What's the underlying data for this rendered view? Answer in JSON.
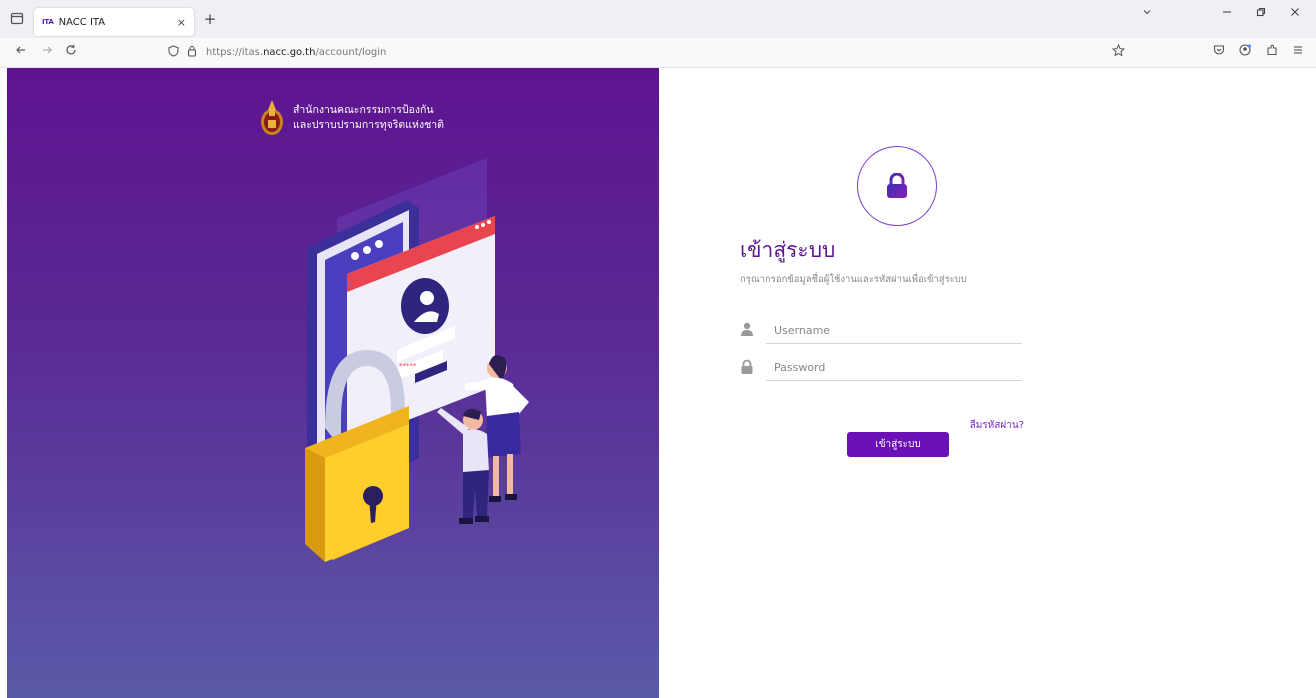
{
  "browser": {
    "tab_title": "NACC ITA",
    "tab_favicon_text": "ITA",
    "tab_close": "×",
    "new_tab": "+",
    "url_prefix": "https://itas.",
    "url_domain": "nacc.go.th",
    "url_path": "/account/login",
    "icons": [
      "tab-list-icon",
      "back-icon",
      "forward-icon",
      "reload-icon",
      "shield-icon",
      "lock-icon",
      "bookmark-star-icon",
      "pocket-icon",
      "account-icon",
      "extensions-icon",
      "menu-icon",
      "minimize-icon",
      "restore-icon",
      "close-icon",
      "tabs-dropdown-icon"
    ]
  },
  "hero": {
    "org_line1": "สำนักงานคณะกรรมการป้องกัน",
    "org_line2": "และปราบปรามการทุจริตแห่งชาติ",
    "colors": {
      "top": "#5e1490",
      "bottom": "#5a5aa8"
    }
  },
  "login": {
    "title": "เข้าสู่ระบบ",
    "subtitle": "กรุณากรอกข้อมูลชื่อผู้ใช้งานและรหัสผ่านเพื่อเข้าสู่ระบบ",
    "username_placeholder": "Username",
    "password_placeholder": "Password",
    "forgot_label": "ลืมรหัสผ่าน?",
    "submit_label": "เข้าสู่ระบบ",
    "accent": "#6a12b6"
  }
}
